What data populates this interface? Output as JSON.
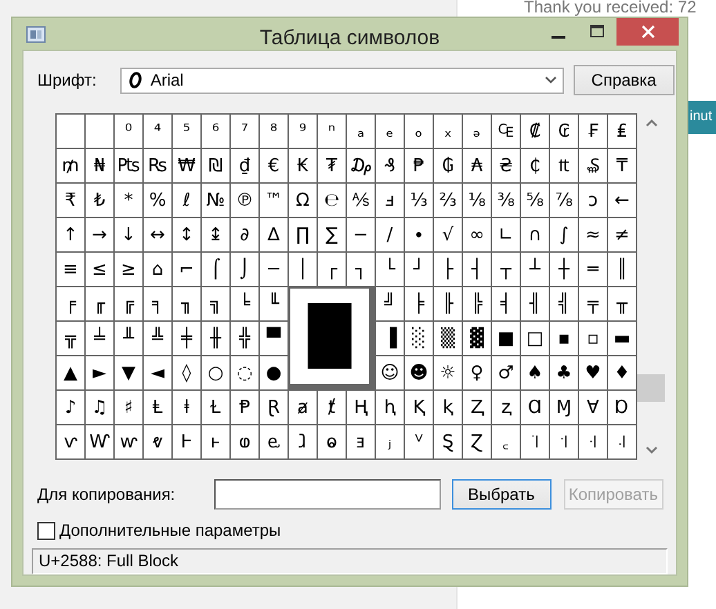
{
  "background": {
    "note": "Thank you received: 72",
    "button": "inut"
  },
  "window": {
    "title": "Таблица символов"
  },
  "font_row": {
    "label": "Шрифт:",
    "font": "Arial",
    "help_button": "Справка"
  },
  "grid": {
    "rows": [
      [
        null,
        null,
        "⁰",
        "⁴",
        "⁵",
        "⁶",
        "⁷",
        "⁸",
        "⁹",
        "ⁿ",
        "ₐ",
        "ₑ",
        "ₒ",
        "ₓ",
        "ₔ",
        "₠",
        "₡",
        "₢",
        "₣",
        "₤"
      ],
      [
        "₥",
        "₦",
        "₧",
        "₨",
        "₩",
        "₪",
        "₫",
        "€",
        "₭",
        "₮",
        "₯",
        "₰",
        "₱",
        "₲",
        "₳",
        "₴",
        "₵",
        "₶",
        "₷",
        "₸"
      ],
      [
        "₹",
        "₺",
        "*",
        "%",
        "ℓ",
        "№",
        "℗",
        "™",
        "Ω",
        "℮",
        "⅍",
        "ⅎ",
        "⅓",
        "⅔",
        "⅛",
        "⅜",
        "⅝",
        "⅞",
        "ↄ",
        "←"
      ],
      [
        "↑",
        "→",
        "↓",
        "↔",
        "↕",
        "↨",
        "∂",
        "∆",
        "∏",
        "∑",
        "−",
        "∕",
        "∙",
        "√",
        "∞",
        "∟",
        "∩",
        "∫",
        "≈",
        "≠"
      ],
      [
        "≡",
        "≤",
        "≥",
        "⌂",
        "⌐",
        "⌠",
        "⌡",
        "─",
        "│",
        "┌",
        "┐",
        "└",
        "┘",
        "├",
        "┤",
        "┬",
        "┴",
        "┼",
        "═",
        "║"
      ],
      [
        "╒",
        "╓",
        "╔",
        "╕",
        "╖",
        "╗",
        "╘",
        "╙",
        "╝",
        "╞",
        "╟",
        "╠",
        "╡",
        "╢",
        "╣",
        "╤",
        "╥"
      ],
      [
        "╦",
        "╧",
        "╨",
        "╩",
        "╪",
        "╫",
        "╬",
        "▀",
        "▐",
        "░",
        "▒",
        "▓",
        "■",
        "□",
        "▪",
        "▫",
        "▬"
      ],
      [
        "▲",
        "►",
        "▼",
        "◄",
        "◊",
        "○",
        "◌",
        "●",
        "☺",
        "☻",
        "☼",
        "♀",
        "♂",
        "♠",
        "♣",
        "♥",
        "♦"
      ],
      [
        "♪",
        "♫",
        "♯",
        "Ⱡ",
        "ⱡ",
        "Ɫ",
        "Ᵽ",
        "Ɽ",
        "ⱥ",
        "ⱦ",
        "Ⱨ",
        "ⱨ",
        "Ⱪ",
        "ⱪ",
        "Ⱬ",
        "ⱬ",
        "Ɑ",
        "Ɱ",
        "Ɐ",
        "Ɒ"
      ],
      [
        "ⱱ",
        "Ⱳ",
        "ⱳ",
        "ⱴ",
        "Ⱶ",
        "ⱶ",
        "ⱷ",
        "ⱸ",
        "ⱹ",
        "ⱺ",
        "ⱻ",
        "ⱼ",
        "ⱽ",
        "Ȿ",
        "Ɀ",
        "꜀",
        "꜈",
        "꜉",
        "꜊",
        "꜋"
      ]
    ],
    "magnified": "█"
  },
  "copy_row": {
    "label": "Для копирования:",
    "select_button": "Выбрать",
    "copy_button": {
      "label": "Копировать",
      "disabled": true
    }
  },
  "advanced": {
    "label": "Дополнительные параметры",
    "checked": false
  },
  "status_bar": "U+2588: Full Block"
}
